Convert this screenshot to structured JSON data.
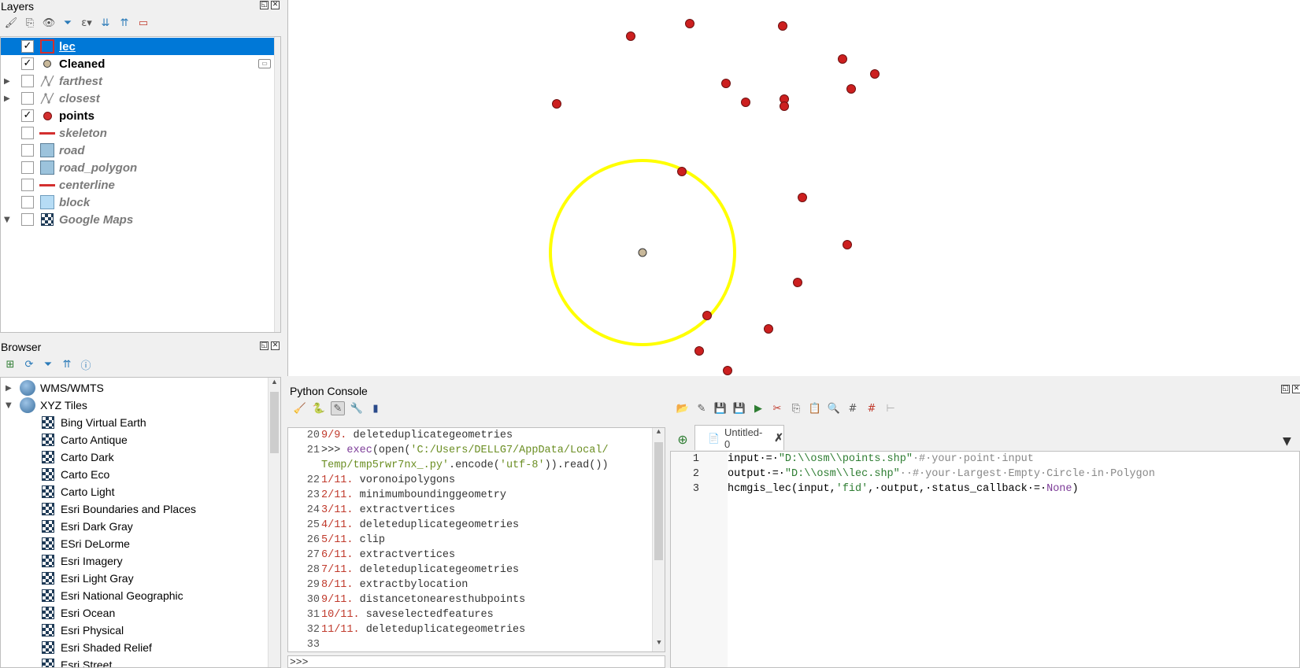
{
  "layers_panel": {
    "title": "Layers",
    "layers": [
      {
        "name": "lec",
        "checked": true,
        "symbol": "red-outline-square",
        "expander": "",
        "visible_style": true
      },
      {
        "name": "Cleaned",
        "checked": true,
        "symbol": "tan-point",
        "expander": "",
        "visible_style": true
      },
      {
        "name": "farthest",
        "checked": false,
        "symbol": "line-vertices",
        "expander": "▶",
        "visible_style": false
      },
      {
        "name": "closest",
        "checked": false,
        "symbol": "line-vertices",
        "expander": "▶",
        "visible_style": false
      },
      {
        "name": "points",
        "checked": true,
        "symbol": "red-point",
        "expander": "",
        "visible_style": true
      },
      {
        "name": "skeleton",
        "checked": false,
        "symbol": "red-line",
        "expander": "",
        "visible_style": false
      },
      {
        "name": "road",
        "checked": false,
        "symbol": "blue-fill",
        "expander": "",
        "visible_style": false
      },
      {
        "name": "road_polygon",
        "checked": false,
        "symbol": "blue-fill",
        "expander": "",
        "visible_style": false
      },
      {
        "name": "centerline",
        "checked": false,
        "symbol": "red-line",
        "expander": "",
        "visible_style": false
      },
      {
        "name": "block",
        "checked": false,
        "symbol": "light-blue-fill",
        "expander": "",
        "visible_style": false
      },
      {
        "name": "Google Maps",
        "checked": false,
        "symbol": "xyz-tile",
        "expander": "▼",
        "visible_style": false
      }
    ]
  },
  "browser_panel": {
    "title": "Browser",
    "groups": [
      {
        "label": "WMS/WMTS",
        "expander": "▶"
      },
      {
        "label": "XYZ Tiles",
        "expander": "▼"
      }
    ],
    "xyz_items": [
      "Bing Virtual Earth",
      "Carto Antique",
      "Carto Dark",
      "Carto Eco",
      "Carto Light",
      "Esri Boundaries and Places",
      "Esri Dark Gray",
      "ESri DeLorme",
      "Esri Imagery",
      "Esri Light Gray",
      "Esri National Geographic",
      "Esri Ocean",
      "Esri Physical",
      "Esri Shaded Relief",
      "Esri Street"
    ]
  },
  "python_console": {
    "title": "Python Console",
    "prompt": ">>>",
    "lines": [
      {
        "num": "20",
        "parts": [
          {
            "t": "9/9.",
            "c": "c-red"
          },
          {
            "t": " deleteduplicategeometries",
            "c": "c-dark"
          }
        ]
      },
      {
        "num": "21",
        "parts": [
          {
            "t": ">>> ",
            "c": "c-dark"
          },
          {
            "t": "exec",
            "c": "c-purple"
          },
          {
            "t": "(open(",
            "c": "c-dark"
          },
          {
            "t": "'C:/Users/DELLG7/AppData/Local/",
            "c": "c-str"
          }
        ]
      },
      {
        "num": "",
        "parts": [
          {
            "t": "Temp/tmp5rwr7nx_.py'",
            "c": "c-str"
          },
          {
            "t": ".encode(",
            "c": "c-dark"
          },
          {
            "t": "'utf-8'",
            "c": "c-str"
          },
          {
            "t": ")).read())",
            "c": "c-dark"
          }
        ]
      },
      {
        "num": "22",
        "parts": [
          {
            "t": "1/11.",
            "c": "c-red"
          },
          {
            "t": " voronoipolygons",
            "c": "c-dark"
          }
        ]
      },
      {
        "num": "23",
        "parts": [
          {
            "t": "2/11.",
            "c": "c-red"
          },
          {
            "t": " minimumboundinggeometry",
            "c": "c-dark"
          }
        ]
      },
      {
        "num": "24",
        "parts": [
          {
            "t": "3/11.",
            "c": "c-red"
          },
          {
            "t": " extractvertices",
            "c": "c-dark"
          }
        ]
      },
      {
        "num": "25",
        "parts": [
          {
            "t": "4/11.",
            "c": "c-red"
          },
          {
            "t": " deleteduplicategeometries",
            "c": "c-dark"
          }
        ]
      },
      {
        "num": "26",
        "parts": [
          {
            "t": "5/11.",
            "c": "c-red"
          },
          {
            "t": " clip",
            "c": "c-dark"
          }
        ]
      },
      {
        "num": "27",
        "parts": [
          {
            "t": "6/11.",
            "c": "c-red"
          },
          {
            "t": " extractvertices",
            "c": "c-dark"
          }
        ]
      },
      {
        "num": "28",
        "parts": [
          {
            "t": "7/11.",
            "c": "c-red"
          },
          {
            "t": " deleteduplicategeometries",
            "c": "c-dark"
          }
        ]
      },
      {
        "num": "29",
        "parts": [
          {
            "t": "8/11.",
            "c": "c-red"
          },
          {
            "t": " extractbylocation",
            "c": "c-dark"
          }
        ]
      },
      {
        "num": "30",
        "parts": [
          {
            "t": "9/11.",
            "c": "c-red"
          },
          {
            "t": " distancetonearesthubpoints",
            "c": "c-dark"
          }
        ]
      },
      {
        "num": "31",
        "parts": [
          {
            "t": "10/11.",
            "c": "c-red"
          },
          {
            "t": " saveselectedfeatures",
            "c": "c-dark"
          }
        ]
      },
      {
        "num": "32",
        "parts": [
          {
            "t": "11/11.",
            "c": "c-red"
          },
          {
            "t": " deleteduplicategeometries",
            "c": "c-dark"
          }
        ]
      },
      {
        "num": "33",
        "parts": []
      }
    ]
  },
  "editor": {
    "tab_label": "Untitled-0",
    "lines": [
      {
        "num": "1",
        "parts": [
          {
            "t": "input·=·",
            "c": ""
          },
          {
            "t": "\"D:\\\\osm\\\\points.shp\"",
            "c": "e-str"
          },
          {
            "t": "·#·your·point·input",
            "c": "e-com"
          }
        ]
      },
      {
        "num": "2",
        "parts": [
          {
            "t": "output·=·",
            "c": ""
          },
          {
            "t": "\"D:\\\\osm\\\\lec.shp\"",
            "c": "e-str"
          },
          {
            "t": "··#·your·Largest·Empty·Circle·in·Polygon",
            "c": "e-com"
          }
        ]
      },
      {
        "num": "3",
        "parts": [
          {
            "t": "hcmgis_lec(input,",
            "c": ""
          },
          {
            "t": "'fid'",
            "c": "e-str"
          },
          {
            "t": ",·output,·status_callback·=·",
            "c": ""
          },
          {
            "t": "None",
            "c": "e-none"
          },
          {
            "t": ")",
            "c": ""
          }
        ]
      }
    ]
  },
  "map": {
    "circle_color": "#ffff00",
    "point_color": "#cc1f1f",
    "center_color": "#c8b89a"
  }
}
